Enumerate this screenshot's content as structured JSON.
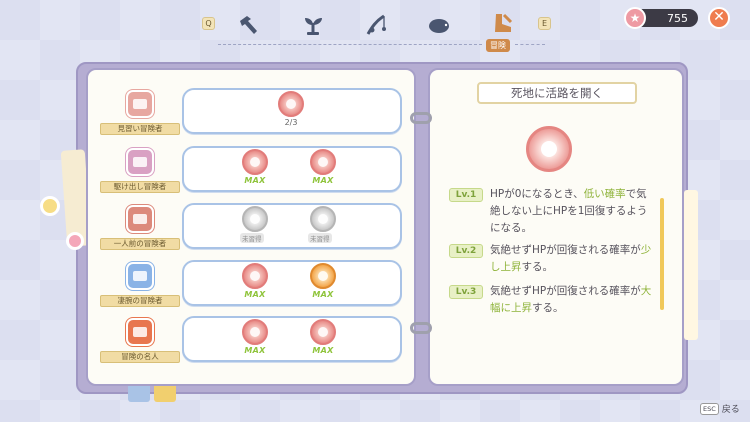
{
  "header": {
    "key_left": "Q",
    "key_right": "E",
    "active_tab_label": "冒険",
    "tabs": [
      {
        "icon": "hammer-icon"
      },
      {
        "icon": "sprout-icon"
      },
      {
        "icon": "fishing-rod-icon"
      },
      {
        "icon": "hedgehog-icon"
      },
      {
        "icon": "adventure-boot-icon"
      }
    ],
    "star_count": "755"
  },
  "ranks": [
    {
      "title": "見習い冒険者",
      "color": "#e7a7a0",
      "skills": [
        {
          "state": "progress",
          "style": "red",
          "label": "2/3"
        }
      ]
    },
    {
      "title": "駆け出し冒険者",
      "color": "#d9a1c3",
      "skills": [
        {
          "state": "max",
          "style": "red",
          "label": "MAX"
        },
        {
          "state": "max",
          "style": "red",
          "label": "MAX"
        }
      ]
    },
    {
      "title": "一人前の冒険者",
      "color": "#dc8a7c",
      "skills": [
        {
          "state": "locked",
          "style": "gray",
          "label": "未習得"
        },
        {
          "state": "locked",
          "style": "gray",
          "label": "未習得"
        }
      ]
    },
    {
      "title": "凄腕の冒険者",
      "color": "#8ab3e6",
      "skills": [
        {
          "state": "max",
          "style": "red",
          "label": "MAX"
        },
        {
          "state": "max",
          "style": "orange",
          "label": "MAX"
        }
      ]
    },
    {
      "title": "冒険の名人",
      "color": "#e8764f",
      "skills": [
        {
          "state": "max",
          "style": "red",
          "label": "MAX"
        },
        {
          "state": "max",
          "style": "red",
          "label": "MAX"
        }
      ]
    }
  ],
  "detail": {
    "title": "死地に活路を開く",
    "levels": [
      {
        "label": "Lv.1",
        "parts": [
          {
            "t": "HPが0になるとき、",
            "h": false
          },
          {
            "t": "低い確率",
            "h": true
          },
          {
            "t": "で気絶しない上にHPを1回復するようになる。",
            "h": false
          }
        ]
      },
      {
        "label": "Lv.2",
        "parts": [
          {
            "t": "気絶せずHPが回復される確率が",
            "h": false
          },
          {
            "t": "少し上昇",
            "h": true
          },
          {
            "t": "する。",
            "h": false
          }
        ]
      },
      {
        "label": "Lv.3",
        "parts": [
          {
            "t": "気絶せずHPが回復される確率が",
            "h": false
          },
          {
            "t": "大幅に上昇",
            "h": true
          },
          {
            "t": "する。",
            "h": false
          }
        ]
      }
    ]
  },
  "footer": {
    "esc_key": "ESC",
    "back_label": "戻る"
  },
  "colors": {
    "accent_green": "#8fb33a",
    "close_button": "#ef7c4f",
    "book_cover": "#b5add2"
  }
}
